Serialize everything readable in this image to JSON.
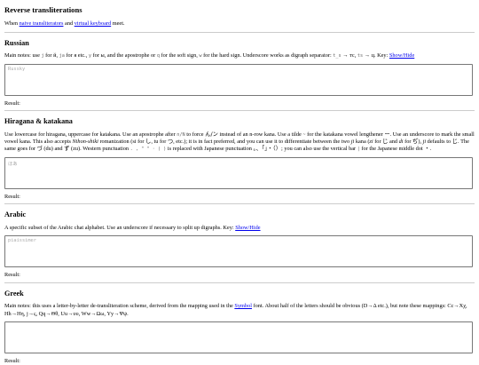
{
  "title": "Reverse transliterations",
  "intro": {
    "prefix": "When ",
    "link1": "naive transliterators",
    "mid": " and ",
    "link2": "virtual keyboard",
    "suffix": " meet."
  },
  "sections": {
    "russian": {
      "heading": "Russian",
      "notes_a": "Main notes: use ",
      "code1": "j",
      "notes_b": " for й, ",
      "code2": "ja",
      "notes_c": " for я etc., ",
      "code3": "y",
      "notes_d": " for ы, and the apostrophe or ",
      "code4": "q",
      "notes_e": " for the soft sign, ",
      "code5": "w",
      "notes_f": " for the hard sign. Underscore works as digraph separator: ",
      "code6": "t_s",
      "notes_g": " → тс, ",
      "code7": "ts",
      "notes_h": " → ц. Key: ",
      "link": "Show/Hide",
      "placeholder": "Russky",
      "result_label": "Result:"
    },
    "hiragana": {
      "heading": "Hiragana & katakana",
      "notes_a": "Use lowercase for hiragana, uppercase for katakana. Use an apostrophe after ",
      "code1": "n/N",
      "notes_b": " to force ",
      "jp1": "ん/ン",
      "notes_c": " instead of an n-row kana. Use a tilde ",
      "code2": "~",
      "notes_d": " for the katakana vowel lengthener ー. Use an underscore to mark the small vowel kana. This also accepts ",
      "italic": "Nihon-shiki",
      "notes_e": " romanization (si for し, tu for つ, etc.); it is in fact preferred, and you can use it to differentiate between the two ",
      "italic2": "ji",
      "notes_f": " kana (",
      "italic3": "zi",
      "notes_g": " for じ and ",
      "italic4": "di",
      "notes_h": " for ぢ), ",
      "italic5": "ji",
      "notes_i": " defaults to じ. The same goes for づ (du) and ず (zu). Western punctuation ",
      "code3": ". , \" \" · ( )",
      "notes_j": " is replaced with Japanese punctuation 。、「」・（）; you can also use the vertical bar ",
      "code4": "|",
      "notes_k": " for the Japanese middle dot ・.",
      "placeholder": "ほあ",
      "result_label": "Result:"
    },
    "arabic": {
      "heading": "Arabic",
      "notes_a": "A specific subset of the Arabic chat alphabet. Use an underscore if necessary to split up digraphs. Key: ",
      "link": "Show/Hide",
      "placeholder": "piaissimer",
      "result_label": "Result:"
    },
    "greek": {
      "heading": "Greek",
      "notes_a": "Main notes: this uses a letter-by-letter de-transliteration scheme, derived from the mapping used in the ",
      "link": "Symbol",
      "notes_b": " font. About half of the letters should be obvious (D→Δ etc.), but note these mappings: Cc→Χχ, Hh→Ηη, j→ς, Qq→Θθ, Uu→υυ, Ww→Ωω, Yy→Ψψ.",
      "placeholder": "",
      "result_label": "Result:"
    }
  }
}
